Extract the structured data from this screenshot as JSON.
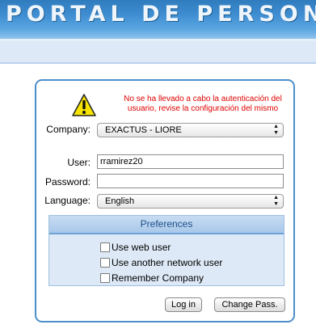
{
  "header": {
    "title": "PORTAL DE PERSONAL"
  },
  "login": {
    "error_message": "No se ha llevado a cabo la autenticación del usuario, revise la configuración del mismo",
    "company": {
      "label": "Company:",
      "value": "EXACTUS - LIORE"
    },
    "user": {
      "label": "User:",
      "value": "rramirez20"
    },
    "password": {
      "label": "Password:",
      "value": ""
    },
    "language": {
      "label": "Language:",
      "value": "English"
    }
  },
  "preferences": {
    "title": "Preferences",
    "options": [
      {
        "label": "Use web user",
        "checked": false
      },
      {
        "label": "Use another network user",
        "checked": false
      },
      {
        "label": "Remember Company",
        "checked": false
      }
    ]
  },
  "buttons": {
    "login": "Log in",
    "change_pass": "Change Pass."
  },
  "colors": {
    "header_blue": "#3d8cd0",
    "panel_border": "#4d8fca",
    "error_red": "#e00000"
  }
}
